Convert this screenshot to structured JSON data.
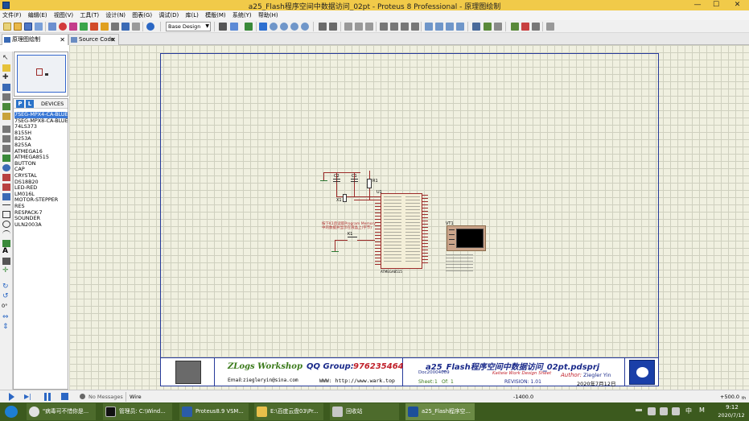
{
  "window": {
    "title": "a25_Flash程序空间中数据访问_02pt - Proteus 8 Professional - 原理图绘制",
    "minimize": "—",
    "maximize": "☐",
    "close": "✕"
  },
  "menu": [
    "文件(F)",
    "编辑(E)",
    "视图(V)",
    "工具(T)",
    "设计(N)",
    "图表(G)",
    "调试(D)",
    "库(L)",
    "模版(M)",
    "系统(Y)",
    "帮助(H)"
  ],
  "toolbar": {
    "layer_select": "Base Design"
  },
  "tabs": [
    {
      "label": "原理图绘制",
      "active": true
    },
    {
      "label": "Source Code",
      "active": false
    }
  ],
  "devices": {
    "p_label": "P",
    "l_label": "L",
    "header": "DEVICES",
    "items": [
      "7SEG-MPX4-CA-BLUE",
      "7SEG-MPX8-CA-BLUE",
      "74LS373",
      "8155H",
      "8253A",
      "8255A",
      "ATMEGA16",
      "ATMEGA8515",
      "BUTTON",
      "CAP",
      "CRYSTAL",
      "DS18B20",
      "LED-RED",
      "LM016L",
      "MOTOR-STEPPER",
      "RES",
      "RESPACK-7",
      "SOUNDER",
      "ULN2003A"
    ],
    "selected_index": 0
  },
  "left_tools": {
    "rotation": "0°"
  },
  "schematic": {
    "c2": "C2",
    "c1": "C1",
    "r1": "R1",
    "u1": "U1",
    "x1": "X1",
    "k1": "K1",
    "vt1": "VT1",
    "note_line1": "按下K1后读取Program Memory",
    "note_line2": "中的数据并显示在液晶上(字节)",
    "mcu_name": "ATMEGA8515"
  },
  "title_block": {
    "workshop": "ZLogs Workshop",
    "qq_group_label": "QQ Group:",
    "qq_group_number": "976235464",
    "email_label": "Email:",
    "email": "ziegleryin@sina.com",
    "www": "WWW: http://www.wark.top",
    "project_title": "a25_Flash程序空间中数据访问_02pt.pdsprj",
    "doc_number": "Doc20004009",
    "design_sheet": "Kaiteie Work Design Sheet",
    "author_label": "Author:",
    "author": "Ziegler Yin",
    "sheet_label": "Sheet:",
    "sheet": "1",
    "of_label": "Of:",
    "of": "1",
    "revision": "REVISION: 1.01",
    "date": "2020年7月12日"
  },
  "status": {
    "messages": "No Messages",
    "mode": "Wire",
    "x": "-1400.0",
    "y": "+500.0",
    "units": "th"
  },
  "taskbar": {
    "items": [
      "\"病毒可不惜你是...",
      "管理员: C:\\Wind...",
      "Proteus8.9 VSM...",
      "E:\\百度云盘03\\Pr...",
      "回收站",
      "a25_Flash程序空..."
    ],
    "clock_time": "9:12",
    "clock_date": "2020/7/12",
    "ime": "中",
    "ime2": "M"
  },
  "colors": {
    "titlebar": "#f1ca49",
    "canvas": "#f0f0e0",
    "wire": "#9c2a28",
    "sheet_border": "#263a9a",
    "taskbar": "#3c5a1e"
  }
}
